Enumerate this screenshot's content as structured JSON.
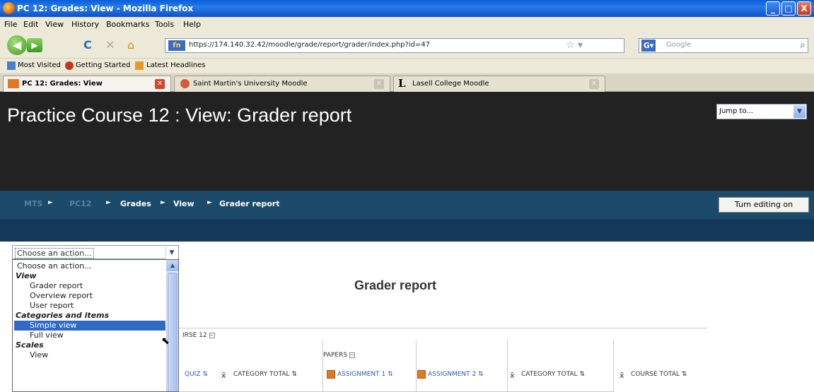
{
  "window": {
    "title": "PC 12: Grades: View - Mozilla Firefox",
    "minimize_label": "_",
    "maximize_label": "□",
    "close_label": "X"
  },
  "menu": [
    "File",
    "Edit",
    "View",
    "History",
    "Bookmarks",
    "Tools",
    "Help"
  ],
  "nav": {
    "back_glyph": "◀",
    "forward_glyph": "▶",
    "reload_glyph": "C",
    "stop_glyph": "✕",
    "home_glyph": "⌂",
    "site_badge": "fn",
    "url": "https://174.140.32.42/moodle/grade/report/grader/index.php?id=47",
    "star_glyph": "☆ ▾",
    "search_engine": "G▾",
    "search_placeholder": "Google",
    "search_glyph": "⌕"
  },
  "bookmarks": [
    "Most Visited",
    "Getting Started",
    "Latest Headlines"
  ],
  "tabs": [
    {
      "label": "PC 12: Grades: View",
      "active": true,
      "close": "✕"
    },
    {
      "label": "Saint Martin's University Moodle",
      "active": false,
      "close": "✕"
    },
    {
      "label": "Lasell College Moodle",
      "active": false,
      "close": "✕"
    }
  ],
  "page": {
    "title": "Practice Course 12 : View: Grader report",
    "jump_to": "Jump to...",
    "breadcrumb": [
      "MTS",
      "PC12",
      "Grades",
      "View",
      "Grader report"
    ],
    "crumb_sep": "►",
    "edit_button": "Turn editing on",
    "report_title": "Grader report"
  },
  "action_select": {
    "value": "Choose an action...",
    "options": [
      {
        "label": "Choose an action...",
        "kind": "top"
      },
      {
        "label": "View",
        "kind": "group"
      },
      {
        "label": "Grader report",
        "kind": "sub"
      },
      {
        "label": "Overview report",
        "kind": "sub"
      },
      {
        "label": "User report",
        "kind": "sub"
      },
      {
        "label": "Categories and items",
        "kind": "group"
      },
      {
        "label": "Simple view",
        "kind": "sub",
        "selected": true
      },
      {
        "label": "Full view",
        "kind": "sub"
      },
      {
        "label": "Scales",
        "kind": "group"
      },
      {
        "label": "View",
        "kind": "sub"
      }
    ]
  },
  "grader_table": {
    "course_category": "IRSE 12",
    "papers": "PAPERS",
    "collapse_glyph": "−",
    "sigma_glyph": "x̄",
    "sort_glyph": "⇅",
    "columns": [
      "QUIZ",
      "CATEGORY TOTAL",
      "ASSIGNMENT 1",
      "ASSIGNMENT 2",
      "CATEGORY TOTAL",
      "COURSE TOTAL"
    ]
  },
  "colors": {
    "header_bg": "#222222",
    "crumb_bg": "#1c4a6a",
    "selected": "#316ac5",
    "assignment_icon": "#e07a22"
  }
}
